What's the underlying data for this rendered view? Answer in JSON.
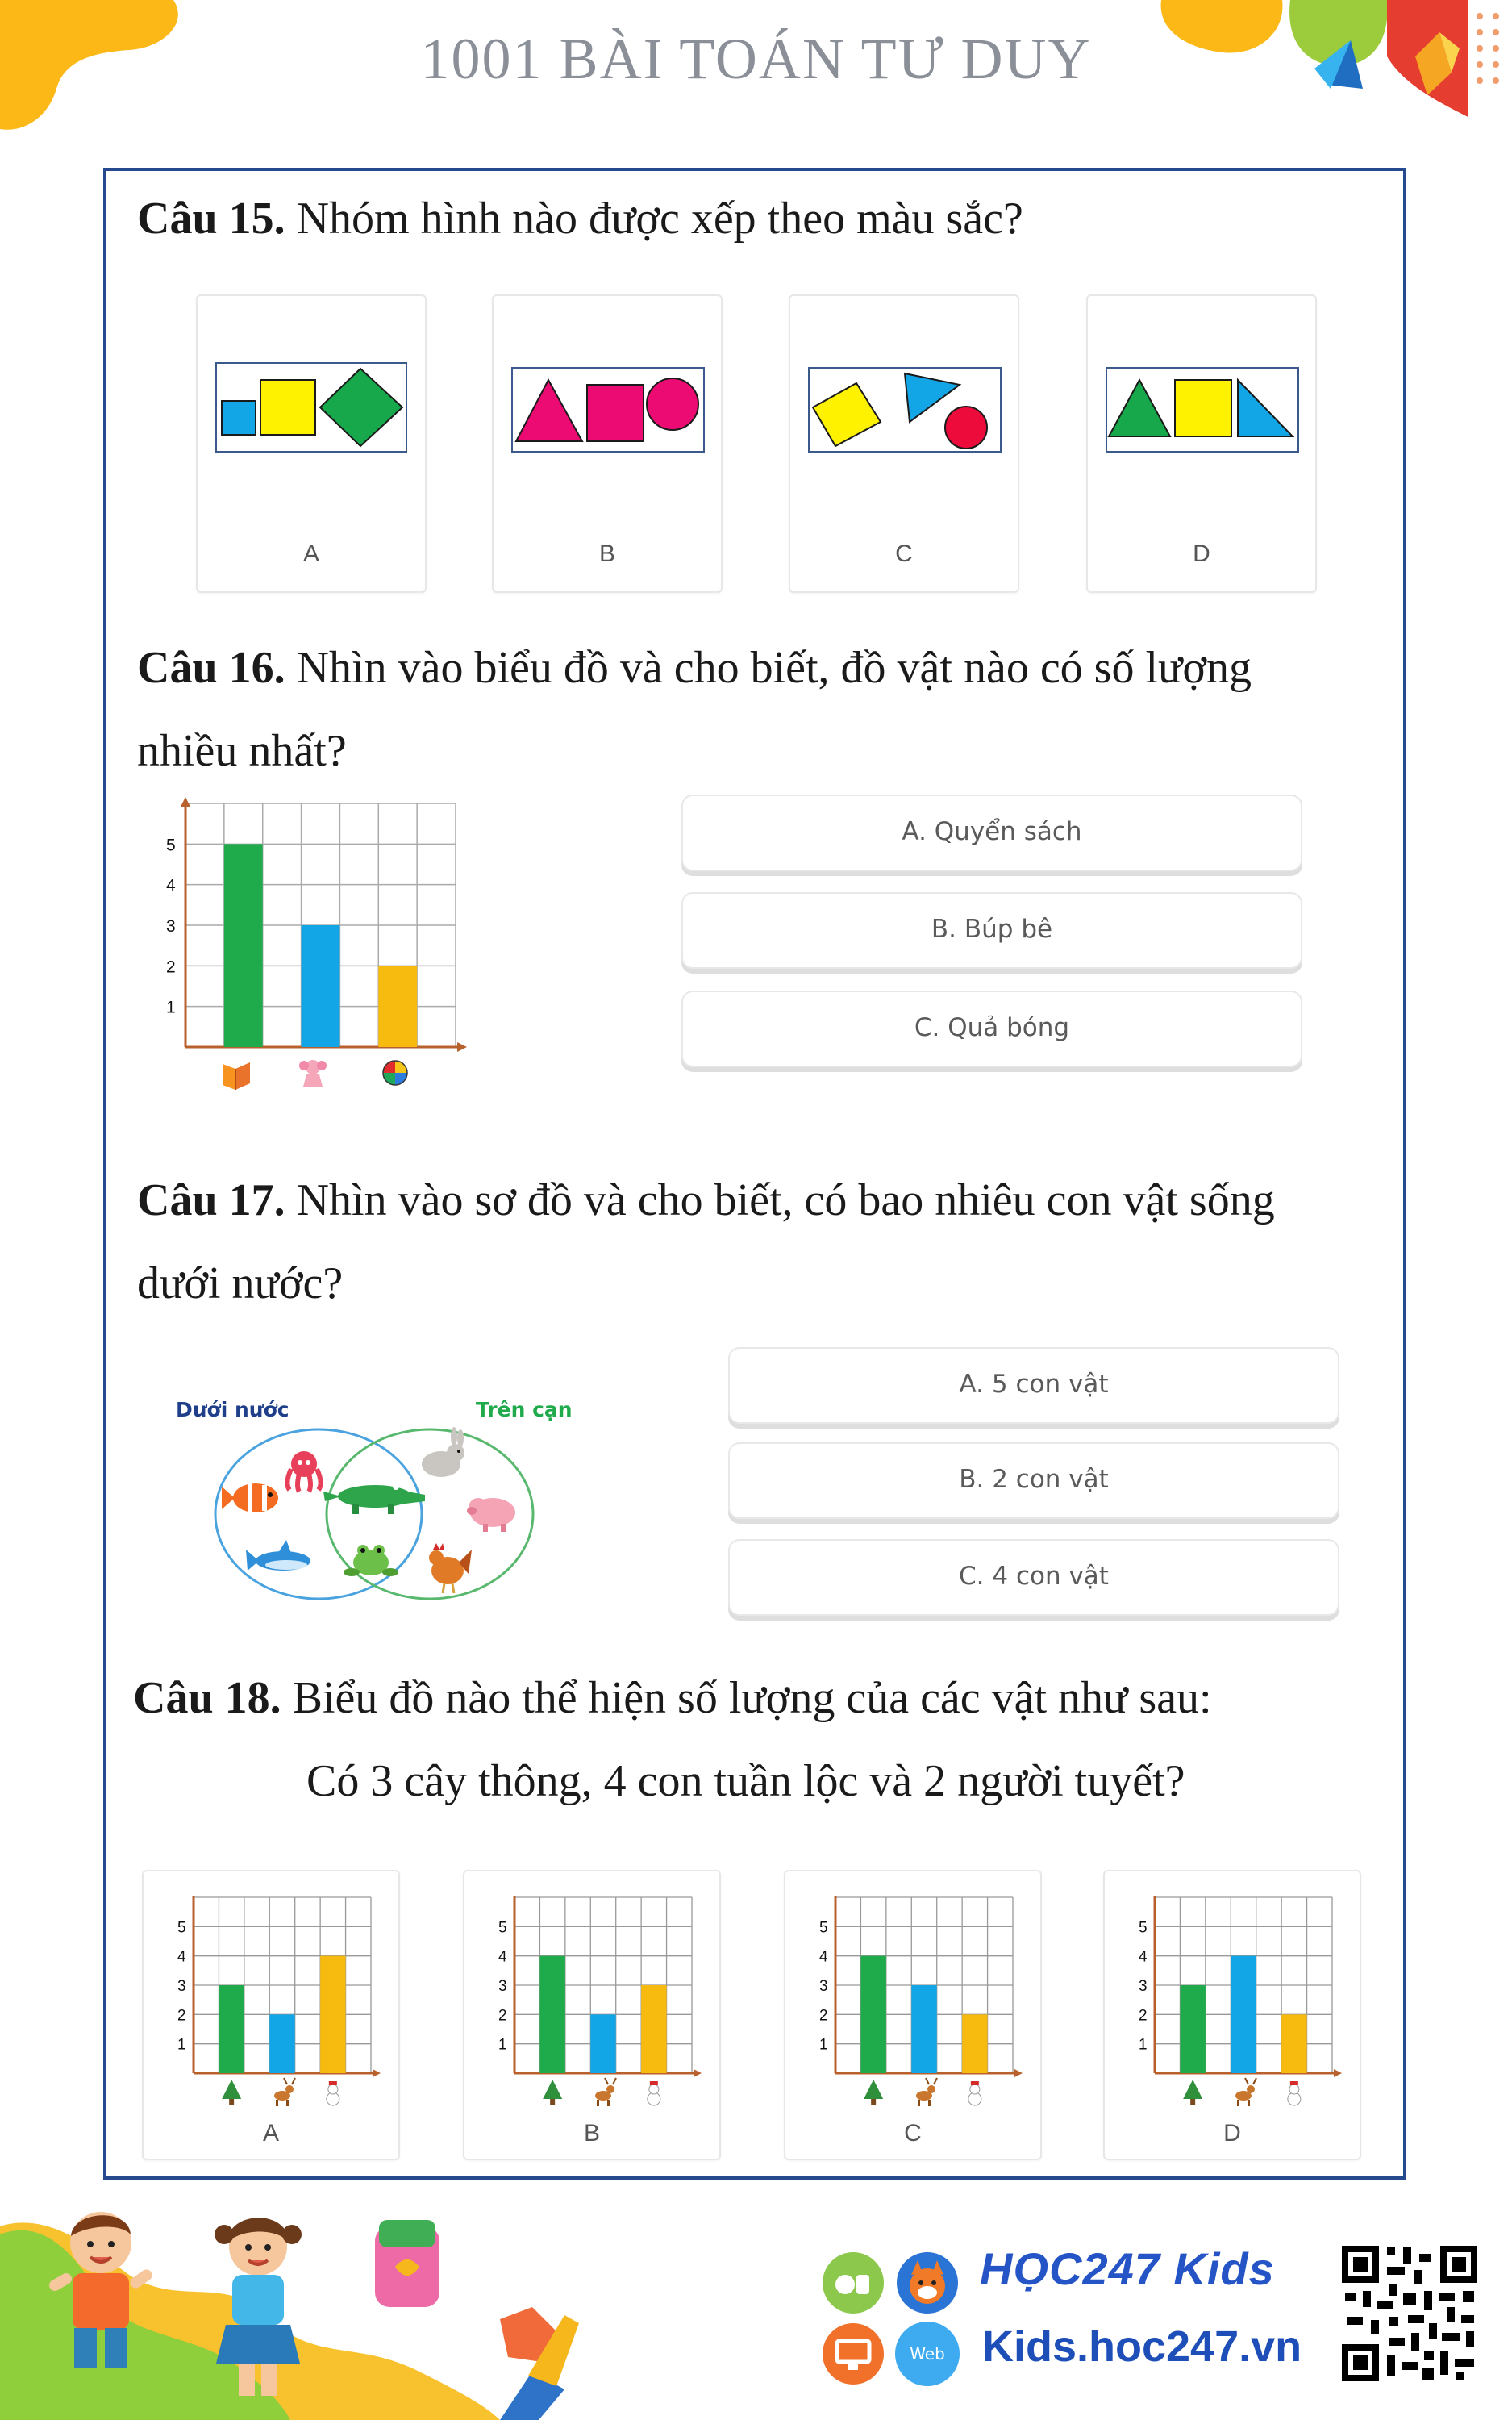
{
  "header": {
    "title": "1001 BÀI TOÁN TƯ DUY"
  },
  "q15": {
    "number": "Câu 15.",
    "text": " Nhóm hình nào được xếp theo màu sắc?",
    "options": [
      "A",
      "B",
      "C",
      "D"
    ]
  },
  "q16": {
    "number": "Câu 16.",
    "text_line1": " Nhìn vào biểu đồ và cho biết, đồ vật nào có số lượng",
    "text_line2": "nhiều nhất?",
    "answers": [
      "A. Quyển sách",
      "B. Búp bê",
      "C. Quả bóng"
    ]
  },
  "q17": {
    "number": "Câu 17.",
    "text_line1": " Nhìn vào sơ đồ và cho biết, có bao nhiêu con vật sống",
    "text_line2": "dưới nước?",
    "venn_left": "Dưới nước",
    "venn_right": "Trên cạn",
    "answers": [
      "A. 5 con vật",
      "B. 2 con vật",
      "C. 4 con vật"
    ]
  },
  "q18": {
    "number": "Câu 18.",
    "text_line1": " Biểu đồ nào thể hiện số lượng của các vật như sau:",
    "text_line2": "Có 3 cây thông, 4 con tuần lộc và 2 người tuyết?",
    "options": [
      "A",
      "B",
      "C",
      "D"
    ]
  },
  "footer": {
    "brand": "HỌC247 Kids",
    "website": "Kids.hoc247.vn",
    "web_badge": "Web"
  },
  "colors": {
    "green": "#1faa4b",
    "blue": "#12a6e6",
    "yellow": "#f6bb0e",
    "frame": "#274a8f"
  },
  "chart_data": [
    {
      "type": "bar",
      "categories": [
        "book",
        "doll",
        "ball"
      ],
      "values": [
        5,
        3,
        2
      ],
      "yticks": [
        "1",
        "2",
        "3",
        "4",
        "5"
      ],
      "ylim": [
        0,
        6
      ]
    },
    {
      "type": "bar",
      "categories": [
        "pine-tree",
        "reindeer",
        "snowman"
      ],
      "values": [
        3,
        2,
        4
      ],
      "label": "A",
      "yticks": [
        "1",
        "2",
        "3",
        "4",
        "5"
      ]
    },
    {
      "type": "bar",
      "categories": [
        "pine-tree",
        "reindeer",
        "snowman"
      ],
      "values": [
        4,
        2,
        3
      ],
      "label": "B",
      "yticks": [
        "1",
        "2",
        "3",
        "4",
        "5"
      ]
    },
    {
      "type": "bar",
      "categories": [
        "pine-tree",
        "reindeer",
        "snowman"
      ],
      "values": [
        4,
        3,
        2
      ],
      "label": "C",
      "yticks": [
        "1",
        "2",
        "3",
        "4",
        "5"
      ]
    },
    {
      "type": "bar",
      "categories": [
        "pine-tree",
        "reindeer",
        "snowman"
      ],
      "values": [
        3,
        4,
        2
      ],
      "label": "D",
      "yticks": [
        "1",
        "2",
        "3",
        "4",
        "5"
      ]
    }
  ]
}
